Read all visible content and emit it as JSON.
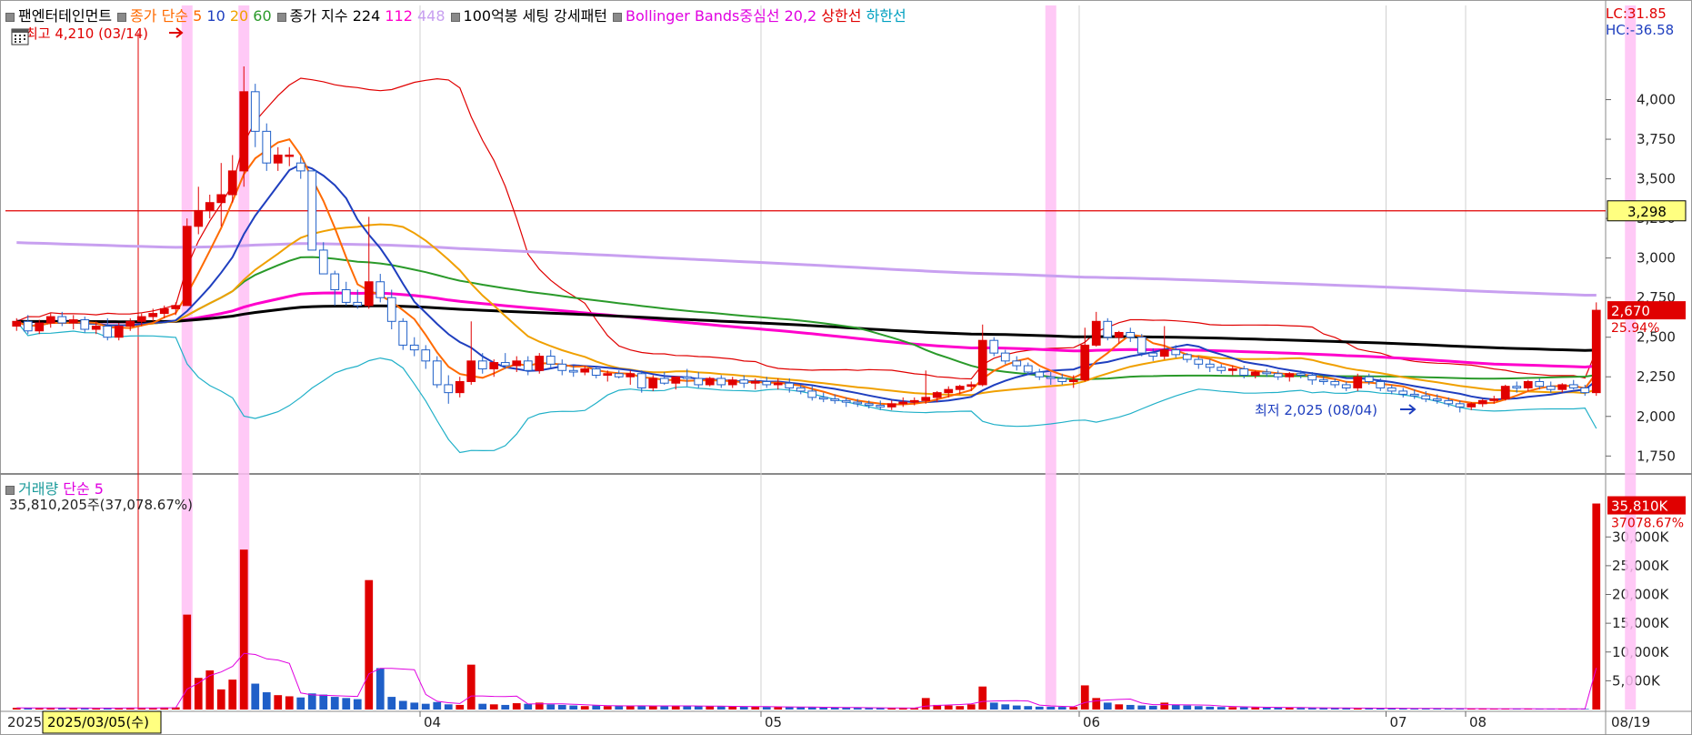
{
  "legend": {
    "name": "팬엔터테인먼트",
    "ma_label": "종가 단순",
    "ma_periods": [
      "5",
      "10",
      "20",
      "60"
    ],
    "ma_colors": [
      "#ff6a00",
      "#1f3fbf",
      "#f0a000",
      "#2a9a2a"
    ],
    "long_label": "종가 지수",
    "long_periods": [
      "224",
      "112",
      "448"
    ],
    "long_colors": [
      "#000000",
      "#ff00cc",
      "#c8a0f0"
    ],
    "setting": "100억봉 세팅 강세패턴",
    "bb": "Bollinger Bands중심선 20,2",
    "upper": "상한선",
    "lower": "하한선",
    "lc": "LC:31.85",
    "hc": "HC:-36.58"
  },
  "annotations": {
    "high": "최고 4,210 (03/14)",
    "low": "최저 2,025 (08/04)",
    "ref_line_label": "3,298",
    "last_price": "2,670",
    "last_change": "25.94%"
  },
  "volume_legend": {
    "title": "거래량",
    "ma": "단순 5",
    "info": "35,810,205주(37,078.67%)",
    "last_label": "35,810K",
    "last_pct": "37078.67%"
  },
  "x_axis": {
    "start": "2025",
    "cursor_date": "2025/03/05(수)",
    "months": [
      "04",
      "05",
      "06",
      "07",
      "08"
    ],
    "end": "08/19"
  },
  "chart_data": {
    "type": "candlestick",
    "y_ticks": [
      "4,000",
      "3,750",
      "3,500",
      "3,250",
      "3,000",
      "2,750",
      "2,500",
      "2,250",
      "2,000",
      "1,750"
    ],
    "y_range": [
      1700,
      4250
    ],
    "vol_ticks": [
      "30,000K",
      "25,000K",
      "20,000K",
      "15,000K",
      "10,000K",
      "5,000K"
    ],
    "vol_range": [
      0,
      37000
    ],
    "reference_line": 3298,
    "candles": [
      [
        2570,
        2620,
        2540,
        2600
      ],
      [
        2600,
        2640,
        2520,
        2540
      ],
      [
        2540,
        2610,
        2520,
        2590
      ],
      [
        2590,
        2650,
        2560,
        2630
      ],
      [
        2630,
        2660,
        2570,
        2590
      ],
      [
        2590,
        2640,
        2550,
        2610
      ],
      [
        2610,
        2630,
        2530,
        2550
      ],
      [
        2550,
        2600,
        2520,
        2570
      ],
      [
        2570,
        2620,
        2480,
        2500
      ],
      [
        2500,
        2590,
        2480,
        2570
      ],
      [
        2570,
        2620,
        2540,
        2600
      ],
      [
        2600,
        2650,
        2570,
        2630
      ],
      [
        2630,
        2680,
        2600,
        2650
      ],
      [
        2650,
        2700,
        2620,
        2680
      ],
      [
        2680,
        2720,
        2640,
        2700
      ],
      [
        2700,
        3250,
        2700,
        3200
      ],
      [
        3200,
        3450,
        3150,
        3300
      ],
      [
        3300,
        3400,
        3250,
        3350
      ],
      [
        3350,
        3600,
        3200,
        3400
      ],
      [
        3400,
        3650,
        3350,
        3550
      ],
      [
        3550,
        4210,
        3450,
        4050
      ],
      [
        4050,
        4100,
        3700,
        3800
      ],
      [
        3800,
        3850,
        3550,
        3600
      ],
      [
        3600,
        3700,
        3550,
        3650
      ],
      [
        3650,
        3700,
        3580,
        3650
      ],
      [
        3600,
        3640,
        3500,
        3550
      ],
      [
        3550,
        3550,
        3180,
        3050
      ],
      [
        3050,
        3100,
        2900,
        2900
      ],
      [
        2900,
        2920,
        2700,
        2800
      ],
      [
        2800,
        2850,
        2700,
        2720
      ],
      [
        2720,
        2800,
        2680,
        2700
      ],
      [
        2700,
        3260,
        2680,
        2850
      ],
      [
        2850,
        2900,
        2720,
        2750
      ],
      [
        2750,
        2800,
        2550,
        2600
      ],
      [
        2600,
        2620,
        2420,
        2450
      ],
      [
        2450,
        2500,
        2380,
        2420
      ],
      [
        2420,
        2450,
        2300,
        2350
      ],
      [
        2350,
        2380,
        2180,
        2200
      ],
      [
        2200,
        2260,
        2080,
        2150
      ],
      [
        2150,
        2250,
        2120,
        2220
      ],
      [
        2220,
        2600,
        2200,
        2350
      ],
      [
        2350,
        2400,
        2270,
        2300
      ],
      [
        2300,
        2360,
        2250,
        2340
      ],
      [
        2340,
        2400,
        2300,
        2320
      ],
      [
        2320,
        2380,
        2280,
        2350
      ],
      [
        2350,
        2380,
        2260,
        2290
      ],
      [
        2290,
        2400,
        2270,
        2380
      ],
      [
        2380,
        2420,
        2300,
        2330
      ],
      [
        2330,
        2360,
        2260,
        2290
      ],
      [
        2290,
        2320,
        2250,
        2280
      ],
      [
        2280,
        2320,
        2260,
        2300
      ],
      [
        2300,
        2320,
        2240,
        2260
      ],
      [
        2260,
        2290,
        2220,
        2270
      ],
      [
        2270,
        2290,
        2240,
        2250
      ],
      [
        2250,
        2290,
        2200,
        2270
      ],
      [
        2270,
        2290,
        2150,
        2180
      ],
      [
        2180,
        2260,
        2160,
        2240
      ],
      [
        2240,
        2280,
        2200,
        2210
      ],
      [
        2210,
        2250,
        2170,
        2250
      ],
      [
        2250,
        2300,
        2190,
        2240
      ],
      [
        2240,
        2280,
        2180,
        2200
      ],
      [
        2200,
        2250,
        2190,
        2240
      ],
      [
        2240,
        2260,
        2180,
        2200
      ],
      [
        2200,
        2250,
        2180,
        2230
      ],
      [
        2230,
        2260,
        2180,
        2210
      ],
      [
        2210,
        2240,
        2170,
        2220
      ],
      [
        2220,
        2250,
        2180,
        2200
      ],
      [
        2200,
        2240,
        2170,
        2210
      ],
      [
        2210,
        2240,
        2150,
        2180
      ],
      [
        2180,
        2200,
        2140,
        2160
      ],
      [
        2160,
        2190,
        2100,
        2120
      ],
      [
        2120,
        2150,
        2090,
        2110
      ],
      [
        2110,
        2140,
        2080,
        2100
      ],
      [
        2100,
        2120,
        2060,
        2090
      ],
      [
        2090,
        2110,
        2060,
        2080
      ],
      [
        2080,
        2100,
        2050,
        2070
      ],
      [
        2070,
        2100,
        2040,
        2060
      ],
      [
        2060,
        2100,
        2040,
        2080
      ],
      [
        2080,
        2120,
        2060,
        2090
      ],
      [
        2090,
        2120,
        2070,
        2100
      ],
      [
        2100,
        2290,
        2080,
        2120
      ],
      [
        2120,
        2160,
        2090,
        2150
      ],
      [
        2150,
        2190,
        2120,
        2170
      ],
      [
        2170,
        2200,
        2140,
        2190
      ],
      [
        2190,
        2220,
        2160,
        2200
      ],
      [
        2200,
        2580,
        2190,
        2480
      ],
      [
        2480,
        2500,
        2380,
        2400
      ],
      [
        2400,
        2420,
        2330,
        2350
      ],
      [
        2350,
        2380,
        2290,
        2320
      ],
      [
        2320,
        2340,
        2260,
        2280
      ],
      [
        2280,
        2300,
        2230,
        2250
      ],
      [
        2250,
        2280,
        2200,
        2240
      ],
      [
        2240,
        2270,
        2200,
        2220
      ],
      [
        2220,
        2260,
        2180,
        2230
      ],
      [
        2230,
        2560,
        2220,
        2450
      ],
      [
        2450,
        2660,
        2440,
        2600
      ],
      [
        2600,
        2620,
        2480,
        2500
      ],
      [
        2500,
        2540,
        2460,
        2530
      ],
      [
        2530,
        2560,
        2470,
        2500
      ],
      [
        2500,
        2520,
        2380,
        2400
      ],
      [
        2400,
        2430,
        2350,
        2380
      ],
      [
        2380,
        2570,
        2360,
        2420
      ],
      [
        2420,
        2450,
        2370,
        2390
      ],
      [
        2390,
        2400,
        2340,
        2360
      ],
      [
        2360,
        2380,
        2300,
        2330
      ],
      [
        2330,
        2360,
        2280,
        2310
      ],
      [
        2310,
        2330,
        2270,
        2290
      ],
      [
        2290,
        2320,
        2260,
        2300
      ],
      [
        2300,
        2320,
        2240,
        2260
      ],
      [
        2260,
        2290,
        2240,
        2280
      ],
      [
        2280,
        2300,
        2250,
        2270
      ],
      [
        2270,
        2290,
        2230,
        2250
      ],
      [
        2250,
        2280,
        2220,
        2270
      ],
      [
        2270,
        2290,
        2240,
        2260
      ],
      [
        2260,
        2280,
        2200,
        2230
      ],
      [
        2230,
        2260,
        2200,
        2220
      ],
      [
        2220,
        2240,
        2180,
        2200
      ],
      [
        2200,
        2220,
        2160,
        2180
      ],
      [
        2180,
        2270,
        2160,
        2250
      ],
      [
        2250,
        2270,
        2200,
        2220
      ],
      [
        2220,
        2240,
        2160,
        2180
      ],
      [
        2180,
        2200,
        2140,
        2160
      ],
      [
        2160,
        2180,
        2120,
        2140
      ],
      [
        2140,
        2170,
        2110,
        2130
      ],
      [
        2130,
        2160,
        2090,
        2110
      ],
      [
        2110,
        2140,
        2080,
        2100
      ],
      [
        2100,
        2120,
        2060,
        2080
      ],
      [
        2080,
        2100,
        2025,
        2060
      ],
      [
        2060,
        2090,
        2040,
        2080
      ],
      [
        2080,
        2110,
        2060,
        2100
      ],
      [
        2100,
        2130,
        2080,
        2110
      ],
      [
        2110,
        2200,
        2100,
        2190
      ],
      [
        2190,
        2220,
        2150,
        2180
      ],
      [
        2180,
        2230,
        2160,
        2220
      ],
      [
        2220,
        2240,
        2170,
        2190
      ],
      [
        2190,
        2220,
        2150,
        2170
      ],
      [
        2170,
        2210,
        2150,
        2200
      ],
      [
        2200,
        2230,
        2170,
        2180
      ],
      [
        2180,
        2200,
        2130,
        2150
      ],
      [
        2150,
        2720,
        2130,
        2670
      ]
    ],
    "volumes": [
      300,
      250,
      280,
      320,
      260,
      240,
      220,
      260,
      300,
      280,
      260,
      290,
      300,
      350,
      380,
      16500,
      5500,
      6800,
      3500,
      5200,
      27800,
      4500,
      3000,
      2500,
      2300,
      2100,
      2800,
      2600,
      2200,
      2000,
      1800,
      22500,
      7200,
      2200,
      1500,
      1200,
      1000,
      1300,
      900,
      800,
      7800,
      1000,
      900,
      800,
      1100,
      1000,
      1200,
      900,
      800,
      700,
      600,
      700,
      600,
      650,
      600,
      700,
      650,
      600,
      620,
      580,
      600,
      560,
      540,
      520,
      500,
      480,
      460,
      440,
      420,
      400,
      380,
      360,
      340,
      320,
      300,
      280,
      260,
      250,
      240,
      230,
      2000,
      800,
      700,
      600,
      900,
      4000,
      1200,
      900,
      700,
      600,
      500,
      480,
      460,
      450,
      4200,
      2000,
      1200,
      900,
      800,
      700,
      650,
      1200,
      800,
      700,
      600,
      500,
      450,
      420,
      400,
      380,
      360,
      340,
      320,
      300,
      280,
      270,
      260,
      250,
      240,
      230,
      220,
      210,
      200,
      190,
      180,
      170,
      160,
      155,
      150,
      145,
      140,
      135,
      130,
      125,
      120,
      115,
      110,
      105,
      100,
      35810
    ],
    "highlight_bars": [
      15,
      20,
      91,
      142
    ],
    "series": [
      {
        "name": "5",
        "values": []
      },
      {
        "name": "10",
        "values": []
      },
      {
        "name": "20",
        "values": []
      },
      {
        "name": "60",
        "values": []
      },
      {
        "name": "224",
        "values": []
      },
      {
        "name": "112",
        "values": []
      },
      {
        "name": "448",
        "values": []
      }
    ]
  }
}
